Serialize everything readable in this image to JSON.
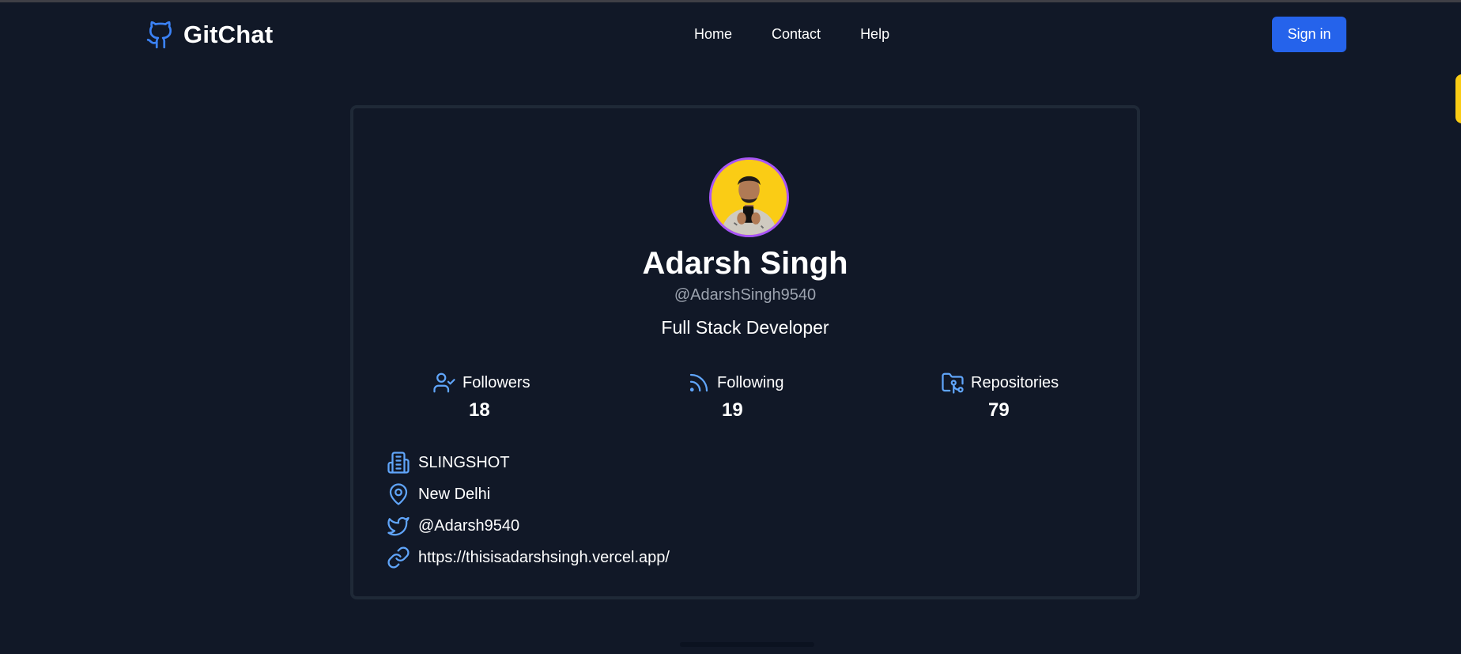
{
  "app": {
    "brand_name": "GitChat",
    "brand_icon": "github-icon",
    "accent_color": "#2563eb"
  },
  "nav": {
    "links": [
      {
        "label": "Home"
      },
      {
        "label": "Contact"
      },
      {
        "label": "Help"
      }
    ],
    "signin_label": "Sign in"
  },
  "profile": {
    "name": "Adarsh Singh",
    "username": "@AdarshSingh9540",
    "bio": "Full Stack Developer",
    "avatar_border_color": "#a855f7",
    "stats": [
      {
        "label": "Followers",
        "value": "18",
        "icon": "user-check-icon"
      },
      {
        "label": "Following",
        "value": "19",
        "icon": "rss-icon"
      },
      {
        "label": "Repositories",
        "value": "79",
        "icon": "folder-git-icon"
      }
    ],
    "details": [
      {
        "text": "SLINGSHOT",
        "icon": "building-icon"
      },
      {
        "text": "New Delhi",
        "icon": "map-pin-icon"
      },
      {
        "text": "@Adarsh9540",
        "icon": "twitter-icon"
      },
      {
        "text": "https://thisisadarshsingh.vercel.app/",
        "icon": "link-icon"
      }
    ]
  }
}
